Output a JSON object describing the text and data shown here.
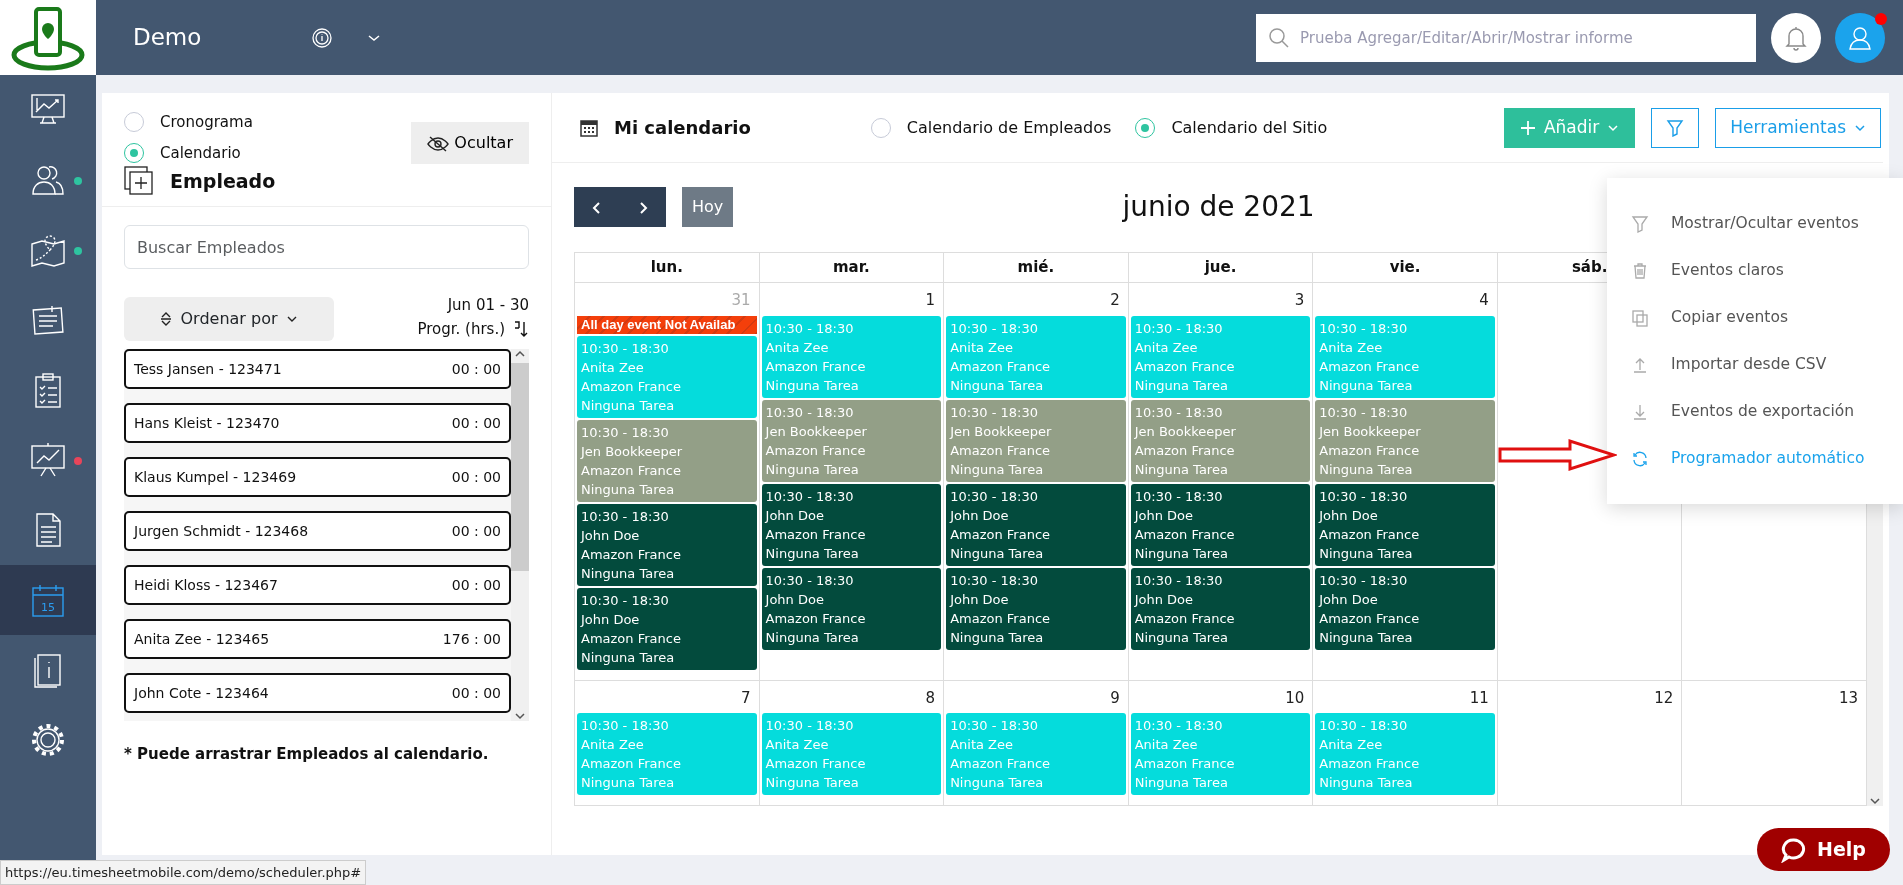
{
  "topbar": {
    "title": "Demo",
    "search": {
      "placeholder": "Prueba Agregar/Editar/Abrir/Mostrar informe"
    },
    "avatar_alert": true
  },
  "sidebar": {
    "items": [
      {
        "selected": false
      },
      {
        "selected": false,
        "color": "#2ec4a0"
      },
      {
        "selected": false,
        "color": "#2ec4a0"
      },
      {
        "selected": false
      },
      {
        "selected": false
      },
      {
        "selected": false,
        "color": "#e8455a"
      },
      {
        "selected": false
      },
      {
        "selected": true,
        "icon_text": "15"
      },
      {
        "selected": false
      },
      {
        "selected": false
      }
    ]
  },
  "left_panel": {
    "views": [
      {
        "label": "Cronograma",
        "selected": false
      },
      {
        "label": "Calendario",
        "selected": true
      }
    ],
    "hide_button": "Ocultar",
    "title": "Empleado",
    "search": {
      "placeholder": "Buscar Empleados"
    },
    "sort_button": "Ordenar por",
    "range": "Jun 01 - 30",
    "hours_label": "Progr. (hrs.)",
    "employees": [
      {
        "name": "Tess Jansen - 123471",
        "hours": "00 : 00"
      },
      {
        "name": "Hans Kleist - 123470",
        "hours": "00 : 00"
      },
      {
        "name": "Klaus Kumpel - 123469",
        "hours": "00 : 00"
      },
      {
        "name": "Jurgen Schmidt - 123468",
        "hours": "00 : 00"
      },
      {
        "name": "Heidi Kloss - 123467",
        "hours": "00 : 00"
      },
      {
        "name": "Anita Zee - 123465",
        "hours": "176 : 00"
      },
      {
        "name": "John Cote - 123464",
        "hours": "00 : 00"
      }
    ],
    "note": "* Puede arrastrar Empleados al calendario."
  },
  "calendar": {
    "title": "Mi calendario",
    "modes": [
      {
        "label": "Calendario de Empleados",
        "selected": false
      },
      {
        "label": "Calendario del Sitio",
        "selected": true
      }
    ],
    "add_button": "Añadir",
    "tools_button": "Herramientas",
    "today_button": "Hoy",
    "month": "junio de 2021",
    "day_headers": [
      "lun.",
      "mar.",
      "mié.",
      "jue.",
      "vie.",
      "sáb."
    ],
    "weeks": [
      {
        "days": [
          {
            "date": "31",
            "outside": true,
            "events": [
              {
                "kind": "allday",
                "title": "All day event Not Availab"
              },
              {
                "kind": "timed",
                "color": "#05dcdc",
                "time": "10:30 - 18:30",
                "employee": "Anita Zee",
                "site": "Amazon France",
                "task": "Ninguna Tarea"
              },
              {
                "kind": "timed",
                "color": "#939f87",
                "time": "10:30 - 18:30",
                "employee": "Jen Bookkeeper",
                "site": "Amazon France",
                "task": "Ninguna Tarea"
              },
              {
                "kind": "timed",
                "color": "#034b3d",
                "time": "10:30 - 18:30",
                "employee": "John Doe",
                "site": "Amazon France",
                "task": "Ninguna Tarea"
              },
              {
                "kind": "timed",
                "color": "#034b3d",
                "time": "10:30 - 18:30",
                "employee": "John Doe",
                "site": "Amazon France",
                "task": "Ninguna Tarea"
              }
            ]
          },
          {
            "date": "1",
            "outside": false,
            "events": [
              {
                "kind": "timed",
                "color": "#05dcdc",
                "time": "10:30 - 18:30",
                "employee": "Anita Zee",
                "site": "Amazon France",
                "task": "Ninguna Tarea"
              },
              {
                "kind": "timed",
                "color": "#939f87",
                "time": "10:30 - 18:30",
                "employee": "Jen Bookkeeper",
                "site": "Amazon France",
                "task": "Ninguna Tarea"
              },
              {
                "kind": "timed",
                "color": "#034b3d",
                "time": "10:30 - 18:30",
                "employee": "John Doe",
                "site": "Amazon France",
                "task": "Ninguna Tarea"
              },
              {
                "kind": "timed",
                "color": "#034b3d",
                "time": "10:30 - 18:30",
                "employee": "John Doe",
                "site": "Amazon France",
                "task": "Ninguna Tarea"
              }
            ]
          },
          {
            "date": "2",
            "outside": false,
            "events": [
              {
                "kind": "timed",
                "color": "#05dcdc",
                "time": "10:30 - 18:30",
                "employee": "Anita Zee",
                "site": "Amazon France",
                "task": "Ninguna Tarea"
              },
              {
                "kind": "timed",
                "color": "#939f87",
                "time": "10:30 - 18:30",
                "employee": "Jen Bookkeeper",
                "site": "Amazon France",
                "task": "Ninguna Tarea"
              },
              {
                "kind": "timed",
                "color": "#034b3d",
                "time": "10:30 - 18:30",
                "employee": "John Doe",
                "site": "Amazon France",
                "task": "Ninguna Tarea"
              },
              {
                "kind": "timed",
                "color": "#034b3d",
                "time": "10:30 - 18:30",
                "employee": "John Doe",
                "site": "Amazon France",
                "task": "Ninguna Tarea"
              }
            ]
          },
          {
            "date": "3",
            "outside": false,
            "events": [
              {
                "kind": "timed",
                "color": "#05dcdc",
                "time": "10:30 - 18:30",
                "employee": "Anita Zee",
                "site": "Amazon France",
                "task": "Ninguna Tarea"
              },
              {
                "kind": "timed",
                "color": "#939f87",
                "time": "10:30 - 18:30",
                "employee": "Jen Bookkeeper",
                "site": "Amazon France",
                "task": "Ninguna Tarea"
              },
              {
                "kind": "timed",
                "color": "#034b3d",
                "time": "10:30 - 18:30",
                "employee": "John Doe",
                "site": "Amazon France",
                "task": "Ninguna Tarea"
              },
              {
                "kind": "timed",
                "color": "#034b3d",
                "time": "10:30 - 18:30",
                "employee": "John Doe",
                "site": "Amazon France",
                "task": "Ninguna Tarea"
              }
            ]
          },
          {
            "date": "4",
            "outside": false,
            "events": [
              {
                "kind": "timed",
                "color": "#05dcdc",
                "time": "10:30 - 18:30",
                "employee": "Anita Zee",
                "site": "Amazon France",
                "task": "Ninguna Tarea"
              },
              {
                "kind": "timed",
                "color": "#939f87",
                "time": "10:30 - 18:30",
                "employee": "Jen Bookkeeper",
                "site": "Amazon France",
                "task": "Ninguna Tarea"
              },
              {
                "kind": "timed",
                "color": "#034b3d",
                "time": "10:30 - 18:30",
                "employee": "John Doe",
                "site": "Amazon France",
                "task": "Ninguna Tarea"
              },
              {
                "kind": "timed",
                "color": "#034b3d",
                "time": "10:30 - 18:30",
                "employee": "John Doe",
                "site": "Amazon France",
                "task": "Ninguna Tarea"
              }
            ]
          }
        ]
      },
      {
        "days": [
          {
            "date": "7",
            "outside": false,
            "events": [
              {
                "kind": "timed",
                "color": "#05dcdc",
                "time": "10:30 - 18:30",
                "employee": "Anita Zee",
                "site": "Amazon France",
                "task": "Ninguna Tarea"
              }
            ]
          },
          {
            "date": "8",
            "outside": false,
            "events": [
              {
                "kind": "timed",
                "color": "#05dcdc",
                "time": "10:30 - 18:30",
                "employee": "Anita Zee",
                "site": "Amazon France",
                "task": "Ninguna Tarea"
              }
            ]
          },
          {
            "date": "9",
            "outside": false,
            "events": [
              {
                "kind": "timed",
                "color": "#05dcdc",
                "time": "10:30 - 18:30",
                "employee": "Anita Zee",
                "site": "Amazon France",
                "task": "Ninguna Tarea"
              }
            ]
          },
          {
            "date": "10",
            "outside": false,
            "events": [
              {
                "kind": "timed",
                "color": "#05dcdc",
                "time": "10:30 - 18:30",
                "employee": "Anita Zee",
                "site": "Amazon France",
                "task": "Ninguna Tarea"
              }
            ]
          },
          {
            "date": "11",
            "outside": false,
            "events": [
              {
                "kind": "timed",
                "color": "#05dcdc",
                "time": "10:30 - 18:30",
                "employee": "Anita Zee",
                "site": "Amazon France",
                "task": "Ninguna Tarea"
              }
            ]
          },
          {
            "date": "12",
            "outside": false
          },
          {
            "date": "13",
            "outside": false
          }
        ]
      }
    ],
    "tools_menu": [
      {
        "label": "Mostrar/Ocultar eventos",
        "selected": false
      },
      {
        "label": "Eventos claros",
        "selected": false
      },
      {
        "label": "Copiar eventos",
        "selected": false
      },
      {
        "label": "Importar desde CSV",
        "selected": false
      },
      {
        "label": "Eventos de exportación",
        "selected": false
      },
      {
        "label": "Programador automático",
        "selected": true
      }
    ]
  },
  "help_button": "Help",
  "status_bar": "https://eu.timesheetmobile.com/demo/scheduler.php#"
}
